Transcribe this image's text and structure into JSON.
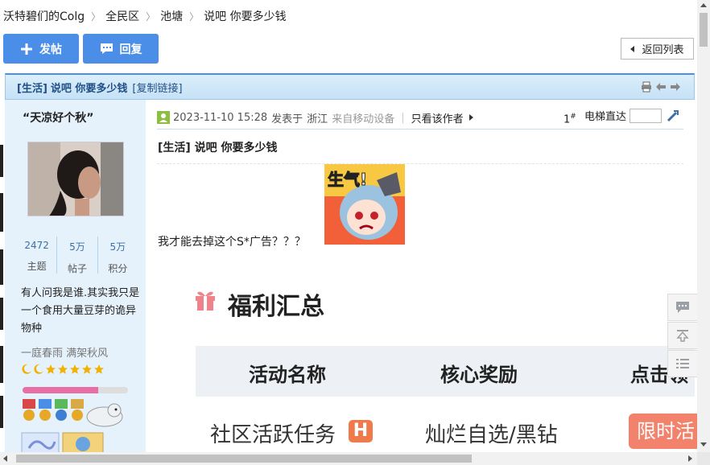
{
  "breadcrumb": {
    "items": [
      "沃特碧们的Colg",
      "全民区",
      "池塘",
      "说吧 你要多少钱"
    ],
    "separator": "〉"
  },
  "actions": {
    "post_label": "发帖",
    "reply_label": "回复",
    "return_label": "返回列表"
  },
  "thread": {
    "category": "[生活]",
    "title": "说吧 你要多少钱",
    "copy_link": "[复制链接]"
  },
  "user": {
    "name": "“天凉好个秋”",
    "stats": [
      {
        "value": "2472",
        "label": "主题"
      },
      {
        "value": "5万",
        "label": "帖子"
      },
      {
        "value": "5万",
        "label": "积分"
      }
    ],
    "bio": "有人问我是谁.其实我只是一个食用大量豆芽的诡异物种",
    "motto": "一庭春雨 满架秋风",
    "level_progress": 0.72
  },
  "post": {
    "date": "2023-11-10 15:28",
    "posted_at": "发表于",
    "location": "浙江",
    "device": "来自移动设备",
    "only_author": "只看该作者",
    "floor": "1",
    "floor_sup": "#",
    "elevator_label": "电梯直达",
    "title": "[生活] 说吧 你要多少钱",
    "text": "我才能去掉这个S*广告？？？",
    "sticker_text": "生气!"
  },
  "welfare": {
    "title": "福利汇总",
    "headers": [
      "活动名称",
      "核心奖励",
      "点击领"
    ],
    "row": {
      "name": "社区活跃任务",
      "badge": "H",
      "reward": "灿烂自选/黑钻",
      "action": "限时活"
    }
  },
  "colors": {
    "accent": "#4b8ee8",
    "header_bg": "#c5e1f6",
    "user_col_bg": "#e5f1fb",
    "pink": "#e86fa5",
    "orange": "#ef7a4b"
  }
}
